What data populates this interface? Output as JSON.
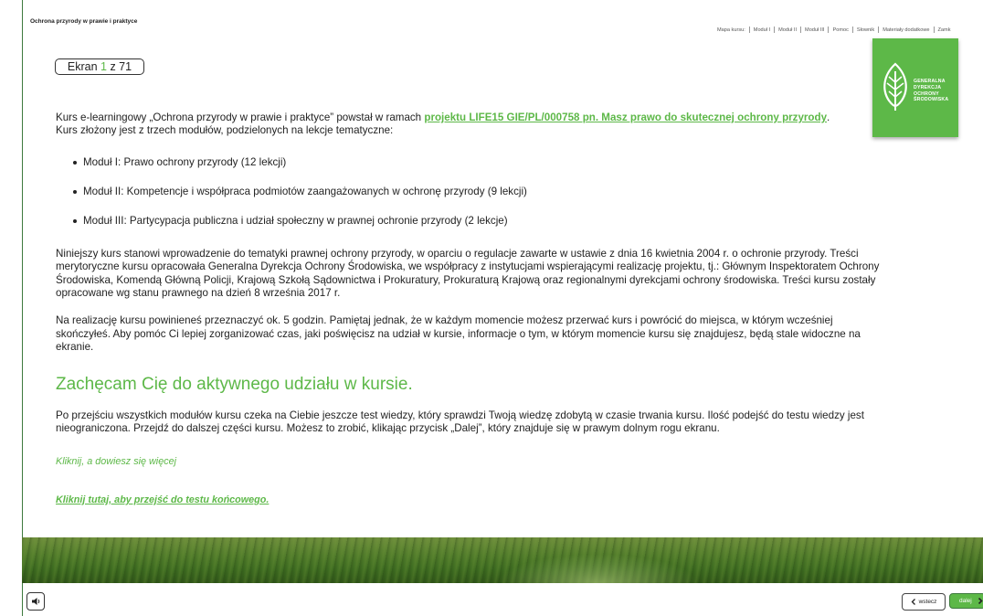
{
  "app": {
    "title": "Ochrona przyrody w prawie i praktyce"
  },
  "topnav": {
    "items": [
      "Mapa kursu:",
      "Moduł I",
      "Moduł II",
      "Moduł III",
      "Pomoc",
      "Słownik",
      "Materiały dodatkowe",
      "Zamk"
    ]
  },
  "counter": {
    "prefix": "Ekran ",
    "current": "1",
    "suffix": " z 71"
  },
  "logo": {
    "lines": [
      "GENERALNA",
      "DYREKCJA",
      "OCHRONY",
      "ŚRODOWISKA"
    ]
  },
  "intro": {
    "text_before": "Kurs e-learningowy „Ochrona przyrody w prawie i praktyce” powstał w ramach ",
    "link": "projektu LIFE15 GIE/PL/000758 pn. Masz prawo do skutecznej ochrony przyrody",
    "text_after": ". Kurs złożony jest z trzech modułów, podzielonych na lekcje tematyczne:"
  },
  "modules": [
    "Moduł I: Prawo ochrony przyrody (12 lekcji)",
    "Moduł II: Kompetencje i współpraca podmiotów zaangażowanych w ochronę przyrody (9 lekcji)",
    "Moduł III: Partycypacja publiczna i udział społeczny w prawnej ochronie przyrody (2 lekcje)"
  ],
  "paragraph1": "Niniejszy kurs stanowi wprowadzenie do tematyki prawnej ochrony przyrody, w oparciu o regulacje zawarte w ustawie z dnia 16 kwietnia 2004 r. o ochronie przyrody. Treści merytoryczne kursu opracowała Generalna Dyrekcja Ochrony Środowiska, we współpracy z instytucjami wspierającymi realizację projektu, tj.: Głównym Inspektoratem Ochrony Środowiska, Komendą Główną Policji, Krajową Szkołą Sądownictwa i Prokuratury, Prokuraturą Krajową oraz regionalnymi dyrekcjami ochrony środowiska. Treści kursu zostały opracowane wg stanu prawnego na dzień 8 września 2017 r.",
  "paragraph2": "Na realizację kursu powinieneś przeznaczyć ok. 5 godzin. Pamiętaj jednak, że w każdym momencie możesz przerwać kurs i powrócić do miejsca, w którym wcześniej skończyłeś. Aby pomóc Ci lepiej zorganizować czas, jaki poświęcisz na udział w kursie, informacje o tym, w którym momencie kursu się znajdujesz, będą stale widoczne na ekranie.",
  "headline": "Zachęcam Cię do aktywnego udziału w kursie.",
  "paragraph3": "Po przejściu wszystkich modułów kursu czeka na Ciebie jeszcze test wiedzy, który sprawdzi Twoją wiedzę zdobytą w czasie trwania kursu. Ilość podejść do testu wiedzy jest nieograniczona. Przejdź do dalszej części kursu. Możesz to zrobić, klikając przycisk „Dalej”, który znajduje się w prawym dolnym rogu ekranu.",
  "more_link": "Kliknij, a dowiesz się więcej",
  "final_link": "Kliknij tutaj, aby przejść do testu końcowego.",
  "footer": {
    "back_label": "wstecz",
    "next_label": "dalej"
  },
  "colors": {
    "accent": "#5db848",
    "frame": "#3e7a3e"
  }
}
